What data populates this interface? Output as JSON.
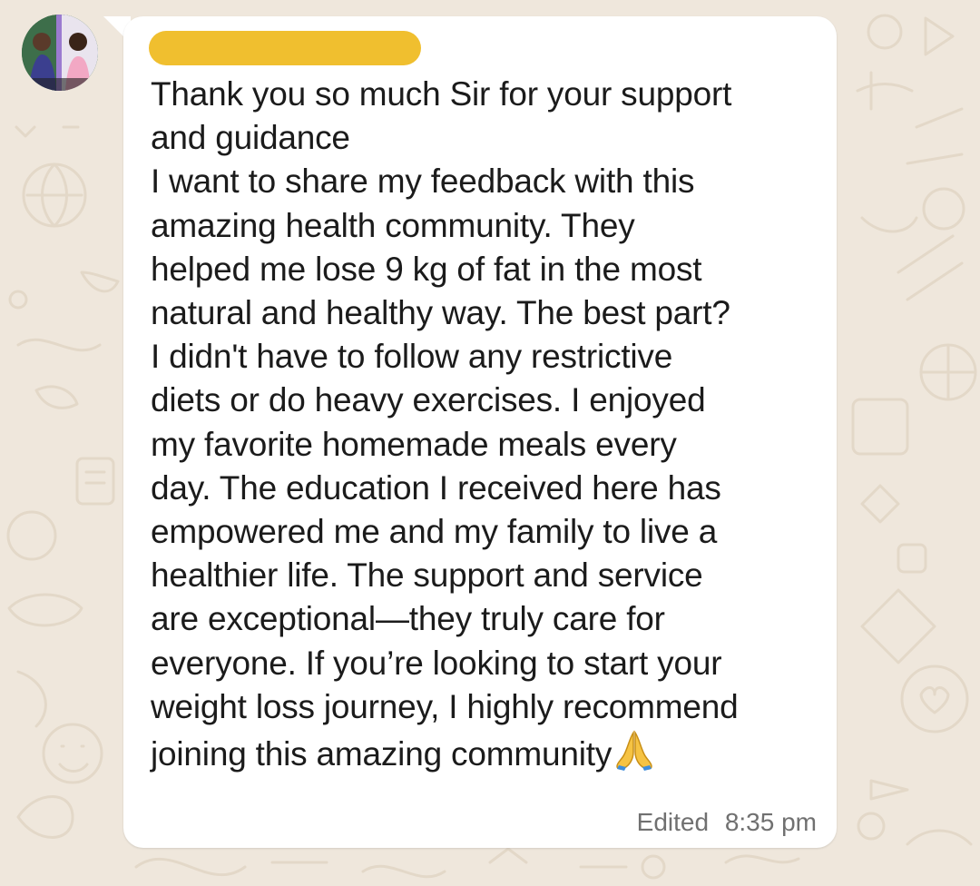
{
  "message": {
    "lines": [
      "Thank you so much Sir for your support",
      "and guidance",
      "I want to share my feedback with this",
      "amazing health community. They",
      "helped me lose 9 kg of fat in the most",
      "natural and healthy way. The best part?",
      "I didn't have to follow any restrictive",
      "diets or do heavy exercises. I enjoyed",
      "my favorite homemade meals every",
      "day. The education I received here has",
      "empowered me and my family to live a",
      "healthier life. The support and service",
      "are exceptional—they truly care for",
      "everyone. If you’re looking to start your",
      "weight loss journey, I highly recommend",
      "joining this amazing community"
    ],
    "emoji_icon": "folded-hands-emoji",
    "edited_label": "Edited",
    "time": "8:35 pm"
  },
  "colors": {
    "chat_background": "#efe7dc",
    "bubble": "#ffffff",
    "redaction": "#f0bf2f",
    "text": "#1b1b1b",
    "meta_text": "#707070"
  },
  "icons": [
    "sender-avatar",
    "folded-hands-emoji",
    "chat-wallpaper-doodles"
  ]
}
